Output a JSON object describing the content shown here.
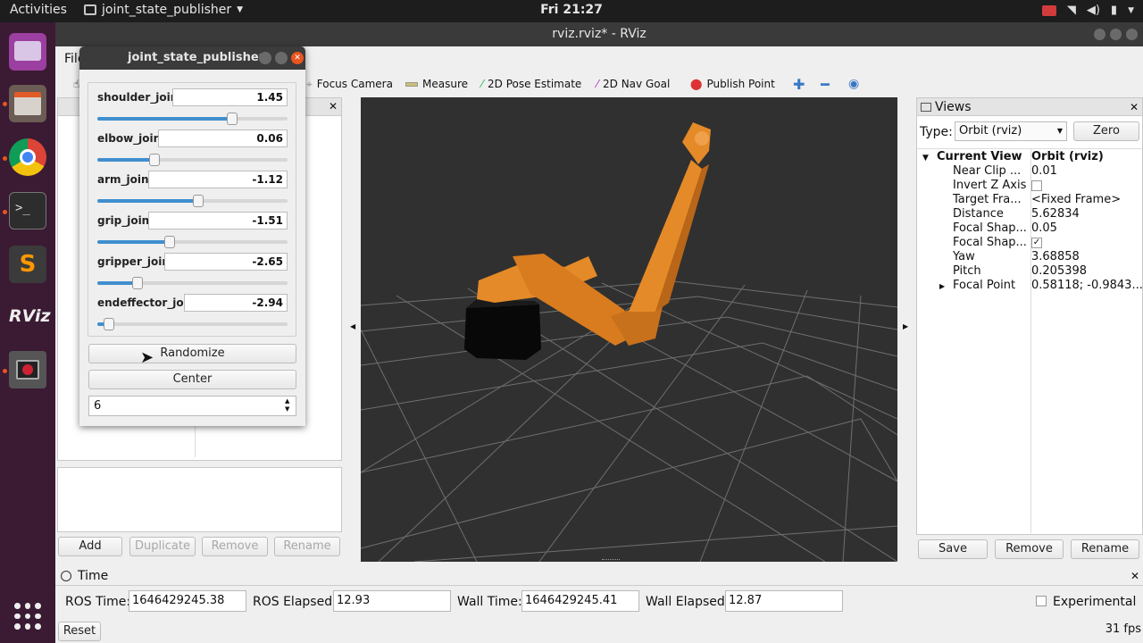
{
  "topbar": {
    "activities": "Activities",
    "app": "joint_state_publisher",
    "clock": "Fri 21:27"
  },
  "window": {
    "title": "rviz.rviz* - RViz",
    "menu_file": "File"
  },
  "toolbar": {
    "focus": "Focus Camera",
    "measure": "Measure",
    "pose": "2D Pose Estimate",
    "nav": "2D Nav Goal",
    "publish": "Publish Point"
  },
  "displays_buttons": {
    "add": "Add",
    "duplicate": "Duplicate",
    "remove": "Remove",
    "rename": "Rename"
  },
  "jsp": {
    "title": "joint_state_publisher",
    "joints": [
      {
        "name": "shoulder_joint",
        "value": "1.45",
        "level": 0.71
      },
      {
        "name": "elbow_joint",
        "value": "0.06",
        "level": 0.3
      },
      {
        "name": "arm_joint",
        "value": "-1.12",
        "level": 0.53
      },
      {
        "name": "grip_joint",
        "value": "-1.51",
        "level": 0.38
      },
      {
        "name": "gripper_joint",
        "value": "-2.65",
        "level": 0.21
      },
      {
        "name": "endeffector_joint",
        "value": "-2.94",
        "level": 0.06
      }
    ],
    "randomize": "Randomize",
    "center": "Center",
    "spin_value": "6"
  },
  "views": {
    "title": "Views",
    "type_label": "Type:",
    "type_value": "Orbit (rviz)",
    "zero": "Zero",
    "current_view": "Current View",
    "current_view_value": "Orbit (rviz)",
    "props": [
      {
        "k": "Near Clip ...",
        "v": "0.01"
      },
      {
        "k": "Invert Z Axis",
        "v": ""
      },
      {
        "k": "Target Fra...",
        "v": "<Fixed Frame>"
      },
      {
        "k": "Distance",
        "v": "5.62834"
      },
      {
        "k": "Focal Shap...",
        "v": "0.05"
      },
      {
        "k": "Focal Shap...",
        "v": ""
      },
      {
        "k": "Yaw",
        "v": "3.68858"
      },
      {
        "k": "Pitch",
        "v": "0.205398"
      },
      {
        "k": "Focal Point",
        "v": "0.58118; -0.9843..."
      }
    ],
    "save": "Save",
    "remove": "Remove",
    "rename": "Rename"
  },
  "time": {
    "title": "Time",
    "ros_time_label": "ROS Time:",
    "ros_time": "1646429245.38",
    "ros_elapsed_label": "ROS Elapsed:",
    "ros_elapsed": "12.93",
    "wall_time_label": "Wall Time:",
    "wall_time": "1646429245.41",
    "wall_elapsed_label": "Wall Elapsed:",
    "wall_elapsed": "12.87",
    "experimental": "Experimental",
    "reset": "Reset",
    "fps": "31 fps"
  },
  "colors": {
    "accent": "#e95420",
    "robot": "#e58a28",
    "slider": "#3f8fcf"
  }
}
